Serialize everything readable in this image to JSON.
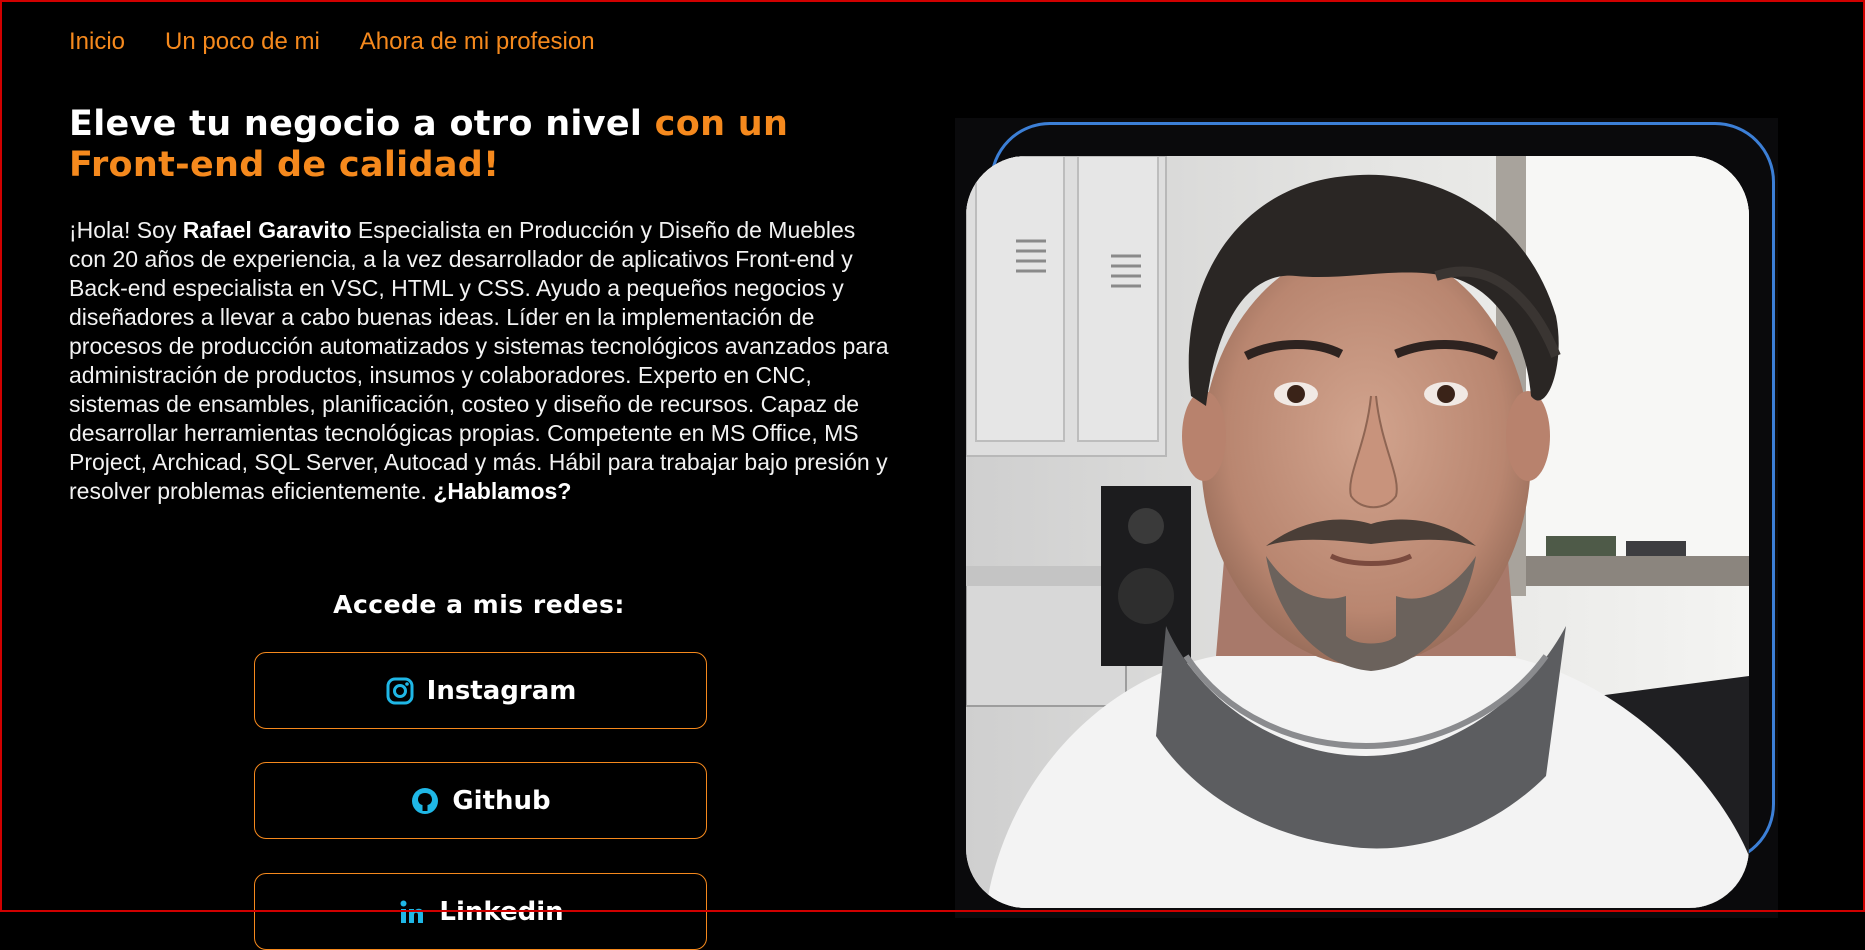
{
  "nav": {
    "items": [
      {
        "label": "Inicio"
      },
      {
        "label": "Un poco de mi"
      },
      {
        "label": "Ahora de mi profesion"
      }
    ]
  },
  "hero": {
    "headline_white": "Eleve tu negocio a otro nivel ",
    "headline_accent": "con un Front-end de calidad!",
    "bio_prefix": "¡Hola! Soy ",
    "bio_name": "Rafael Garavito",
    "bio_body": " Especialista en Producción y Diseño de Muebles con 20 años de experiencia, a la vez desarrollador de aplicativos Front-end y Back-end especialista en VSC, HTML y CSS. Ayudo a pequeños negocios y diseñadores a llevar a cabo buenas ideas. Líder en la implementación de procesos de producción automatizados y sistemas tecnológicos avanzados para administración de productos, insumos y colaboradores. Experto en CNC, sistemas de ensambles, planificación, costeo y diseño de recursos. Capaz de desarrollar herramientas tecnológicas propias. Competente en MS Office, MS Project, Archicad, SQL Server, Autocad y más. Hábil para trabajar bajo presión y resolver problemas eficientemente. ",
    "bio_cta": "¿Hablamos?"
  },
  "socials": {
    "title": "Accede a mis redes:",
    "buttons": [
      {
        "label": "Instagram",
        "icon": "instagram-icon"
      },
      {
        "label": "Github",
        "icon": "github-icon"
      },
      {
        "label": "Linkedin",
        "icon": "linkedin-icon"
      }
    ]
  },
  "colors": {
    "accent": "#f5891d",
    "icon": "#1fb7e6",
    "outline": "#3c7fd6",
    "background": "#000000"
  }
}
